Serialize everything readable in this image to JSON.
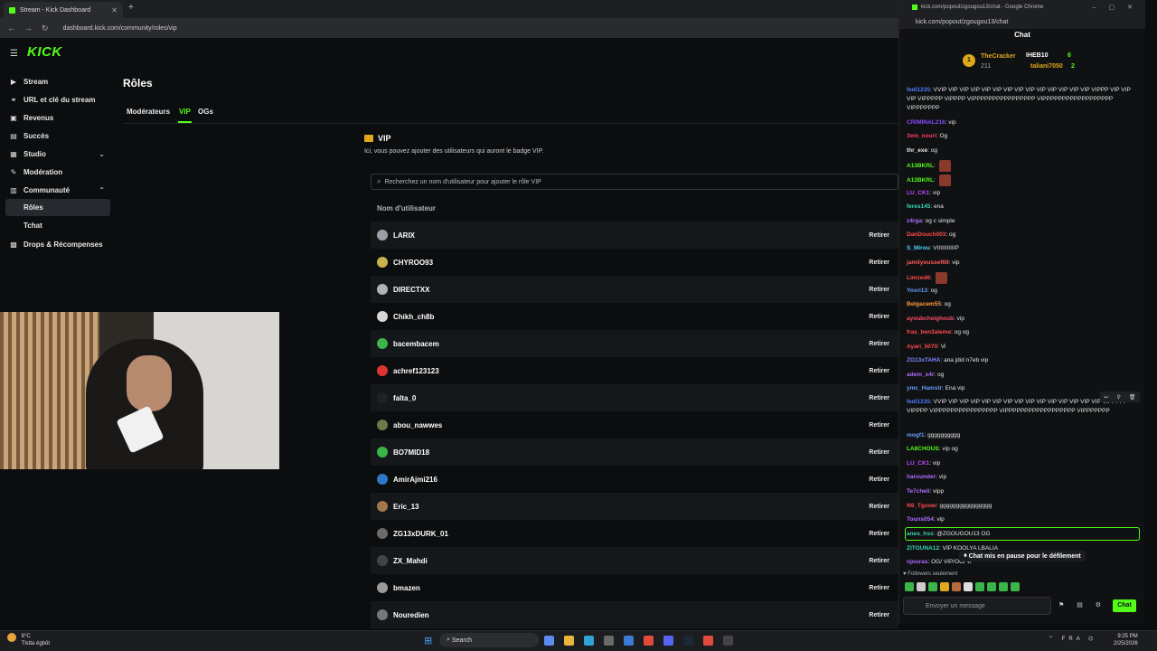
{
  "browser": {
    "tab_title": "Stream - Kick Dashboard",
    "url": "dashboard.kick.com/community/roles/vip"
  },
  "logo": "KICK",
  "sidebar": {
    "items": [
      {
        "label": "Stream",
        "icon": "play-icon"
      },
      {
        "label": "URL et clé du stream",
        "icon": "link-icon"
      },
      {
        "label": "Revenus",
        "icon": "revenue-icon"
      },
      {
        "label": "Succès",
        "icon": "trophy-icon"
      },
      {
        "label": "Studio",
        "icon": "studio-icon"
      },
      {
        "label": "Modération",
        "icon": "moderation-icon"
      },
      {
        "label": "Communauté",
        "icon": "community-icon"
      },
      {
        "label": "Drops & Récompenses",
        "icon": "gift-icon"
      }
    ],
    "sub_items": [
      "Rôles",
      "Tchat"
    ]
  },
  "page": {
    "title": "Rôles",
    "tabs": [
      "Modérateurs",
      "VIP",
      "OGs"
    ],
    "active_tab": "VIP",
    "section_title": "VIP",
    "section_desc": "Ici, vous pouvez ajouter des utilisateurs qui auront le badge VIP.",
    "search_placeholder": "Recherchez un nom d'utilisateur pour ajouter le rôle VIP",
    "column_header": "Nom d'utilisateur",
    "remove_label": "Retirer",
    "users": [
      "LARIX",
      "CHYROO93",
      "DIRECTXX",
      "Chikh_ch8b",
      "bacembacem",
      "achref123123",
      "falta_0",
      "abou_nawwes",
      "BO7MID18",
      "AmirAjmi216",
      "Eric_13",
      "ZG13xDURK_01",
      "ZX_Mahdi",
      "bmazen",
      "Nouredien"
    ]
  },
  "chat": {
    "window_title": "kick.com/popout/zgougou13/chat - Google Chrome",
    "url": "kick.com/popout/zgougou13/chat",
    "header": "Chat",
    "gifters": {
      "first": {
        "name": "TheCracker",
        "count": "211"
      },
      "second": {
        "name": "IHEB10",
        "count": "6"
      },
      "third": {
        "name": "taliani7050",
        "count": "2"
      }
    },
    "messages": [
      {
        "user": "fedi1235",
        "color": "#4f7cff",
        "text": "VVIP VIP VIP VIP VIP VIP VIP VIP VIP VIP VIP VIP VIP VIP VIPPP VIP VIP VIP VIPPPPP VIPPPP VIPPPPPPPPPPPPPPPP VIPPPPPPPPPPPPPPPPPP VIPPPPPPP"
      },
      {
        "user": "CRIMINAL216",
        "color": "#8a4bff",
        "text": "vip"
      },
      {
        "user": "3em_nouri",
        "color": "#ff3b5c",
        "text": "Og"
      },
      {
        "user": "thr_exe",
        "color": "#e6e6e6",
        "text": "og"
      },
      {
        "user": "A13BKRL",
        "color": "#53fc18",
        "text": ""
      },
      {
        "user": "A13BKRL",
        "color": "#53fc18",
        "text": ""
      },
      {
        "user": "LU_CK1",
        "color": "#c04bff",
        "text": "vip"
      },
      {
        "user": "feres145",
        "color": "#37d6b4",
        "text": "ena"
      },
      {
        "user": "z4rga",
        "color": "#b06bff",
        "text": "og c simple"
      },
      {
        "user": "DanDouch003",
        "color": "#ff4b4b",
        "text": "og"
      },
      {
        "user": "S_Mirou",
        "color": "#4fd3ff",
        "text": "VIIIIIIIIIIIP"
      },
      {
        "user": "jamilyoussef69",
        "color": "#ff5a5a",
        "text": "vip"
      },
      {
        "user": "Limzed6",
        "color": "#ff4b4b",
        "text": ""
      },
      {
        "user": "Yosri13",
        "color": "#6b9bff",
        "text": "og"
      },
      {
        "user": "Belgacem55",
        "color": "#ff9a3b",
        "text": "og"
      },
      {
        "user": "ayoubcheighoub",
        "color": "#ff4b6b",
        "text": "vip"
      },
      {
        "user": "fras_ben3aleme",
        "color": "#ff4b4b",
        "text": "og og"
      },
      {
        "user": "Ayari_5070",
        "color": "#ff4b4b",
        "text": "Vi"
      },
      {
        "user": "ZG13xTAHA",
        "color": "#7a8bff",
        "text": "ana jdid n7eb vip"
      },
      {
        "user": "adem_x4r",
        "color": "#b06bff",
        "text": "og"
      },
      {
        "user": "ymc_Hamstr",
        "color": "#6b9bff",
        "text": "Ena vip"
      },
      {
        "user": "fedi1235",
        "color": "#4f7cff",
        "text": "VVIP VIP VIP VIP VIP VIP VIP VIP VIP VIP VIP VIP VIP VIP VIP VIPPPPP VIPPPP VIPPPPPPPPPPPPPPPP VIPPPPPPPPPPPPPPPPPP VIPPPPPPP"
      },
      {
        "user": "mogf1",
        "color": "#6b9bff",
        "text": "gggggggggg"
      },
      {
        "user": "LA8CHOUS",
        "color": "#53fc18",
        "text": "vip og"
      },
      {
        "user": "LU_CK1",
        "color": "#c04bff",
        "text": "vip"
      },
      {
        "user": "harounder",
        "color": "#b06bff",
        "text": "vip"
      },
      {
        "user": "Te7cheli",
        "color": "#b06bff",
        "text": "vipp"
      },
      {
        "user": "N9_Tgoow",
        "color": "#ff4b4b",
        "text": "gggggggggggggggg"
      },
      {
        "user": "Touns054",
        "color": "#b06bff",
        "text": "vip"
      },
      {
        "user": "anes_hss",
        "color": "#37d6b4",
        "text": "@ZGOUGOU13 OG"
      },
      {
        "user": "ZITOUNA12",
        "color": "#37d6b4",
        "text": "VIP KOOLYA LBALIA"
      },
      {
        "user": "njouras",
        "color": "#b06bff",
        "text": "OG/ VIP/OG/ vi"
      }
    ],
    "paused": "Chat mis en pause pour le défilement",
    "followers_only": "Followers seulement",
    "input_placeholder": "Envoyer un message",
    "send_label": "Chat"
  },
  "taskbar": {
    "temp": "8°C",
    "weather": "Tlstta égbôt",
    "search": "Search",
    "lang": "FRA",
    "time": "9:25 PM",
    "date": "2/25/2026"
  },
  "colors": {
    "accent": "#53fc18",
    "bg": "#0b0d0f",
    "row_alt": "#15181b"
  }
}
